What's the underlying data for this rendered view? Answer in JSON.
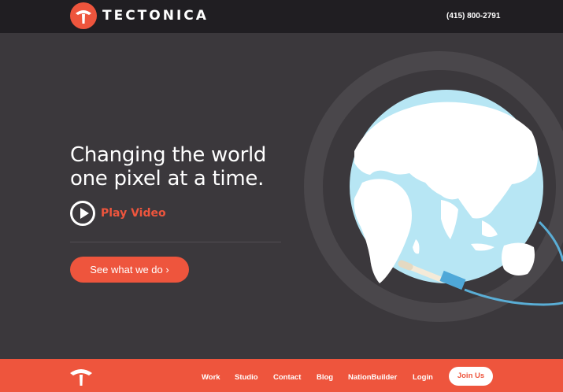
{
  "header": {
    "brand": "TECTONICA",
    "phone": "(415) 800-2791"
  },
  "hero": {
    "headline_line1": "Changing the world",
    "headline_line2": "one pixel at a time.",
    "play_label": "Play Video",
    "cta_label": "See what we do ›"
  },
  "footer_nav": {
    "items": [
      {
        "label": "Work"
      },
      {
        "label": "Studio"
      },
      {
        "label": "Contact"
      },
      {
        "label": "Blog"
      },
      {
        "label": "NationBuilder"
      },
      {
        "label": "Login"
      }
    ],
    "join_label": "Join Us"
  },
  "colors": {
    "accent": "#ee553d",
    "topbar": "#201e22",
    "hero_bg": "#3b383c",
    "globe_ocean": "#b7e6f4",
    "cable": "#5aaed6"
  },
  "icons": {
    "logo": "tectonica-logo-icon",
    "play": "play-icon",
    "globe": "globe-illustration"
  }
}
